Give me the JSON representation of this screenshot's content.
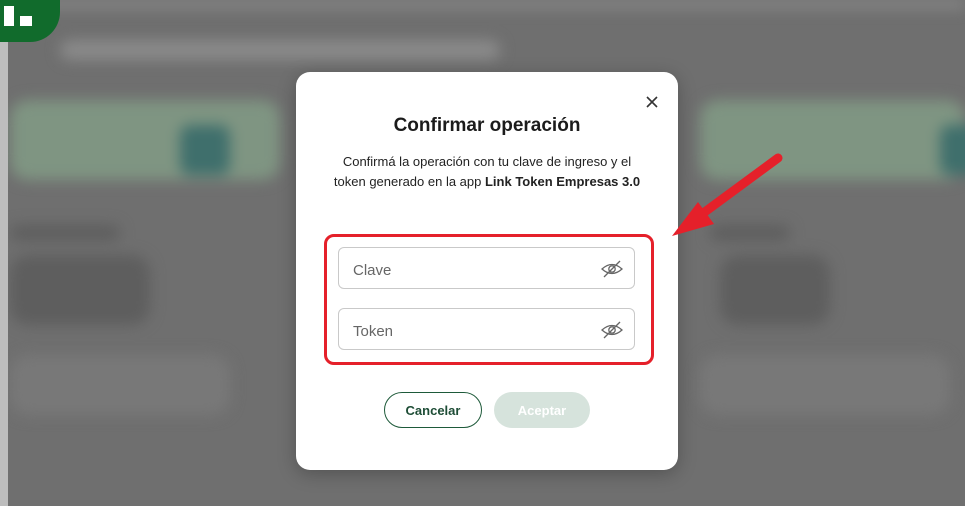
{
  "modal": {
    "title": "Confirmar operación",
    "description_prefix": "Confirmá la operación con tu clave de ingreso y el token generado en la app ",
    "description_bold": "Link Token Empresas 3.0",
    "close_icon": "close-icon",
    "fields": {
      "clave_placeholder": "Clave",
      "token_placeholder": "Token",
      "visibility_icon": "eye-slash-icon"
    },
    "buttons": {
      "cancel_label": "Cancelar",
      "accept_label": "Aceptar",
      "accept_enabled": false
    }
  },
  "annotation": {
    "highlight_color": "#e5202a",
    "arrow_icon": "red-arrow-icon"
  },
  "colors": {
    "primary_green": "#1e5a3a",
    "accept_disabled_bg": "#d6e3dc",
    "overlay": "#6f6f6f"
  }
}
